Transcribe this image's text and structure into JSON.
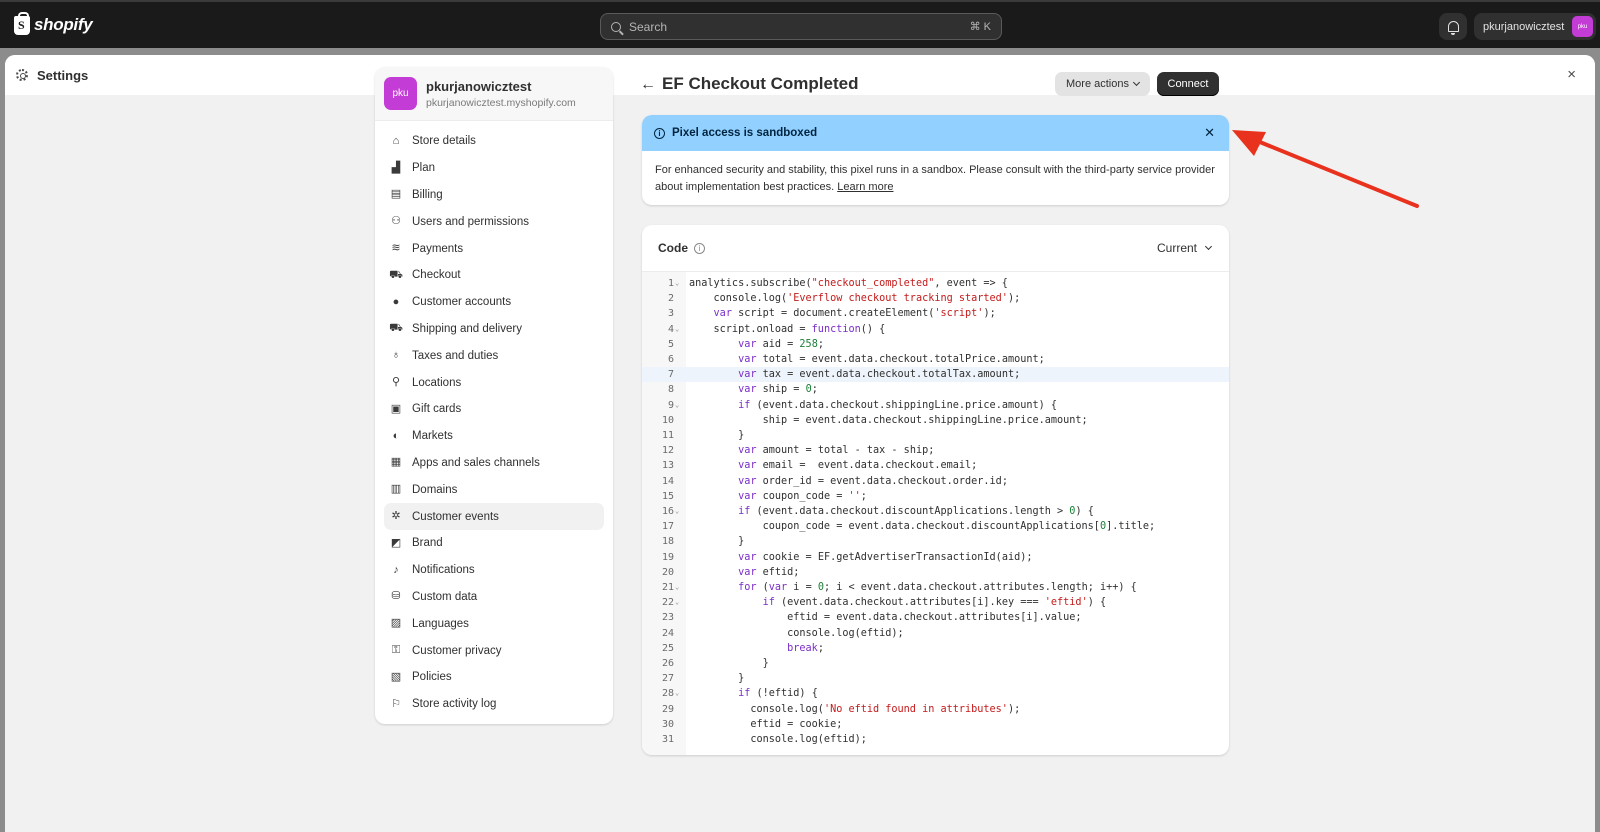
{
  "topbar": {
    "brand": "shopify",
    "search_placeholder": "Search",
    "search_shortcut": "⌘ K",
    "user_name": "pkurjanowicztest",
    "user_avatar": "pku"
  },
  "window": {
    "title": "Settings",
    "close_icon": "×"
  },
  "store": {
    "avatar": "pku",
    "name": "pkurjanowicztest",
    "url": "pkurjanowicztest.myshopify.com"
  },
  "sidebar": {
    "items": [
      {
        "label": "Store details",
        "icon": "⌂"
      },
      {
        "label": "Plan",
        "icon": "▟"
      },
      {
        "label": "Billing",
        "icon": "▤"
      },
      {
        "label": "Users and permissions",
        "icon": "⚇"
      },
      {
        "label": "Payments",
        "icon": "≋"
      },
      {
        "label": "Checkout",
        "icon": "⛟"
      },
      {
        "label": "Customer accounts",
        "icon": "●"
      },
      {
        "label": "Shipping and delivery",
        "icon": "⛟"
      },
      {
        "label": "Taxes and duties",
        "icon": "♁"
      },
      {
        "label": "Locations",
        "icon": "⚲"
      },
      {
        "label": "Gift cards",
        "icon": "▣"
      },
      {
        "label": "Markets",
        "icon": "◐"
      },
      {
        "label": "Apps and sales channels",
        "icon": "▦"
      },
      {
        "label": "Domains",
        "icon": "▥"
      },
      {
        "label": "Customer events",
        "icon": "✲"
      },
      {
        "label": "Brand",
        "icon": "◩"
      },
      {
        "label": "Notifications",
        "icon": "♪"
      },
      {
        "label": "Custom data",
        "icon": "⛁"
      },
      {
        "label": "Languages",
        "icon": "▨"
      },
      {
        "label": "Customer privacy",
        "icon": "⚿"
      },
      {
        "label": "Policies",
        "icon": "▧"
      },
      {
        "label": "Store activity log",
        "icon": "⚐"
      }
    ],
    "active": "Customer events"
  },
  "page": {
    "title": "EF Checkout Completed",
    "more_actions": "More actions",
    "connect": "Connect"
  },
  "banner": {
    "title": "Pixel access is sandboxed",
    "body": "For enhanced security and stability, this pixel runs in a sandbox. Please consult with the third-party service provider about implementation best practices.",
    "link": "Learn more"
  },
  "code": {
    "label": "Code",
    "version": "Current",
    "highlight_line": 7,
    "lines": [
      {
        "n": "1",
        "fold": true,
        "text": "analytics.subscribe(\"checkout_completed\", event => {"
      },
      {
        "n": "2",
        "fold": false,
        "text": "    console.log('Everflow checkout tracking started');"
      },
      {
        "n": "3",
        "fold": false,
        "text": "    var script = document.createElement('script');"
      },
      {
        "n": "4",
        "fold": true,
        "text": "    script.onload = function() {"
      },
      {
        "n": "5",
        "fold": false,
        "text": "        var aid = 258;"
      },
      {
        "n": "6",
        "fold": false,
        "text": "        var total = event.data.checkout.totalPrice.amount;"
      },
      {
        "n": "7",
        "fold": false,
        "text": "        var tax = event.data.checkout.totalTax.amount;"
      },
      {
        "n": "8",
        "fold": false,
        "text": "        var ship = 0;"
      },
      {
        "n": "9",
        "fold": true,
        "text": "        if (event.data.checkout.shippingLine.price.amount) {"
      },
      {
        "n": "10",
        "fold": false,
        "text": "            ship = event.data.checkout.shippingLine.price.amount;"
      },
      {
        "n": "11",
        "fold": false,
        "text": "        }"
      },
      {
        "n": "12",
        "fold": false,
        "text": "        var amount = total - tax - ship;"
      },
      {
        "n": "13",
        "fold": false,
        "text": "        var email =  event.data.checkout.email;"
      },
      {
        "n": "14",
        "fold": false,
        "text": "        var order_id = event.data.checkout.order.id;"
      },
      {
        "n": "15",
        "fold": false,
        "text": "        var coupon_code = '';"
      },
      {
        "n": "16",
        "fold": true,
        "text": "        if (event.data.checkout.discountApplications.length > 0) {"
      },
      {
        "n": "17",
        "fold": false,
        "text": "            coupon_code = event.data.checkout.discountApplications[0].title;"
      },
      {
        "n": "18",
        "fold": false,
        "text": "        }"
      },
      {
        "n": "19",
        "fold": false,
        "text": "        var cookie = EF.getAdvertiserTransactionId(aid);"
      },
      {
        "n": "20",
        "fold": false,
        "text": "        var eftid;"
      },
      {
        "n": "21",
        "fold": true,
        "text": "        for (var i = 0; i < event.data.checkout.attributes.length; i++) {"
      },
      {
        "n": "22",
        "fold": true,
        "text": "            if (event.data.checkout.attributes[i].key === 'eftid') {"
      },
      {
        "n": "23",
        "fold": false,
        "text": "                eftid = event.data.checkout.attributes[i].value;"
      },
      {
        "n": "24",
        "fold": false,
        "text": "                console.log(eftid);"
      },
      {
        "n": "25",
        "fold": false,
        "text": "                break;"
      },
      {
        "n": "26",
        "fold": false,
        "text": "            }"
      },
      {
        "n": "27",
        "fold": false,
        "text": "        }"
      },
      {
        "n": "28",
        "fold": true,
        "text": "        if (!eftid) {"
      },
      {
        "n": "29",
        "fold": false,
        "text": "          console.log('No eftid found in attributes');"
      },
      {
        "n": "30",
        "fold": false,
        "text": "          eftid = cookie;"
      },
      {
        "n": "31",
        "fold": false,
        "text": "          console.log(eftid);"
      }
    ]
  },
  "annotation": {
    "arrow_color": "#e8321e"
  }
}
